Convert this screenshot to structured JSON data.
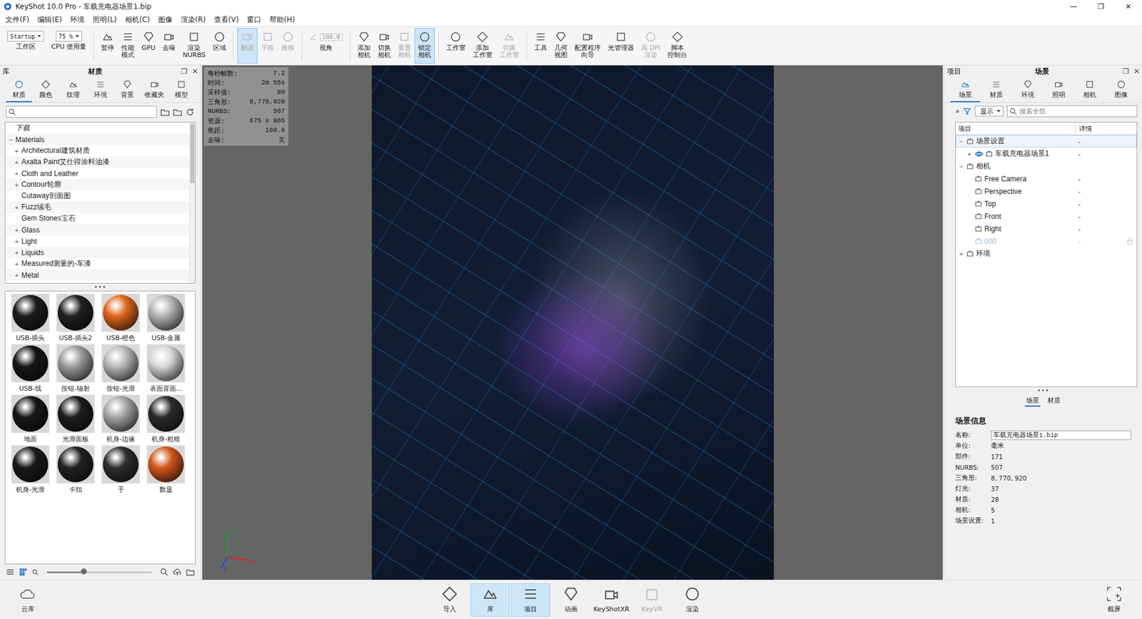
{
  "window": {
    "title": "KeyShot 10.0 Pro  - 车载充电器场景1.bip",
    "controls": [
      "—",
      "❐",
      "✕"
    ]
  },
  "menu": [
    "文件(F)",
    "编辑(E)",
    "环境",
    "照明(L)",
    "相机(C)",
    "图像",
    "渲染(R)",
    "查看(V)",
    "窗口",
    "帮助(H)"
  ],
  "toolbar": [
    {
      "items": [
        {
          "kind": "dropdown",
          "value": "Startup",
          "label": "工作区",
          "disabled": false,
          "selected": false
        },
        {
          "kind": "dropdown",
          "value": "75 %",
          "label": "CPU 使用量",
          "disabled": false,
          "selected": false
        }
      ]
    },
    {
      "items": [
        {
          "kind": "button",
          "label": "暂停",
          "disabled": false,
          "selected": false
        },
        {
          "kind": "button",
          "label": "性能\n模式",
          "disabled": false,
          "selected": false
        },
        {
          "kind": "button",
          "label": "GPU",
          "disabled": false,
          "selected": false
        },
        {
          "kind": "button",
          "label": "去噪",
          "disabled": false,
          "selected": false
        },
        {
          "kind": "button",
          "label": "渲染\nNURBS",
          "disabled": false,
          "selected": false
        },
        {
          "kind": "button",
          "label": "区域",
          "disabled": false,
          "selected": false
        }
      ]
    },
    {
      "items": [
        {
          "kind": "button",
          "label": "翻滚",
          "disabled": true,
          "selected": true
        },
        {
          "kind": "button",
          "label": "平移",
          "disabled": true,
          "selected": false
        },
        {
          "kind": "button",
          "label": "推移",
          "disabled": true,
          "selected": false
        }
      ]
    },
    {
      "items": [
        {
          "kind": "field",
          "value": "100.0",
          "label": "视角",
          "disabled": false,
          "selected": false
        }
      ]
    },
    {
      "items": [
        {
          "kind": "button",
          "label": "添加\n相机",
          "disabled": false,
          "selected": false
        },
        {
          "kind": "button",
          "label": "切换\n相机",
          "disabled": false,
          "selected": false
        },
        {
          "kind": "button",
          "label": "重置\n相机",
          "disabled": true,
          "selected": false
        },
        {
          "kind": "button",
          "label": "锁定\n相机",
          "disabled": false,
          "selected": true
        }
      ]
    },
    {
      "items": [
        {
          "kind": "button",
          "label": "工作室",
          "disabled": false,
          "selected": false
        },
        {
          "kind": "button",
          "label": "添加\n工作室",
          "disabled": false,
          "selected": false
        },
        {
          "kind": "button",
          "label": "切换\n工作室",
          "disabled": true,
          "selected": false
        }
      ]
    },
    {
      "items": [
        {
          "kind": "button",
          "label": "工具",
          "disabled": false,
          "selected": false
        },
        {
          "kind": "button",
          "label": "几何\n视图",
          "disabled": false,
          "selected": false
        },
        {
          "kind": "button",
          "label": "配置程序\n向导",
          "disabled": false,
          "selected": false
        },
        {
          "kind": "button",
          "label": "光管理器",
          "disabled": false,
          "selected": false
        },
        {
          "kind": "button",
          "label": "高 DPI\n渲染",
          "disabled": true,
          "selected": false
        },
        {
          "kind": "button",
          "label": "脚本\n控制台",
          "disabled": false,
          "selected": false
        }
      ]
    }
  ],
  "library": {
    "panel": "库",
    "title": "材质",
    "controls": [
      "❐",
      "✕"
    ],
    "tabs": [
      {
        "label": "材质",
        "selected": true
      },
      {
        "label": "颜色",
        "selected": false
      },
      {
        "label": "纹理",
        "selected": false
      },
      {
        "label": "环境",
        "selected": false
      },
      {
        "label": "背景",
        "selected": false
      },
      {
        "label": "收藏夹",
        "selected": false
      },
      {
        "label": "模型",
        "selected": false
      }
    ],
    "tree": [
      {
        "label": "下载",
        "toggle": "",
        "depth": 0,
        "italic": true
      },
      {
        "label": "Materials",
        "toggle": "−",
        "depth": 0,
        "italic": false
      },
      {
        "label": "Architectural建筑材质",
        "toggle": "+",
        "depth": 1,
        "italic": false
      },
      {
        "label": "Axalta Paint艾仕得涂料油漆",
        "toggle": "+",
        "depth": 1,
        "italic": false
      },
      {
        "label": "Cloth and Leather",
        "toggle": "+",
        "depth": 1,
        "italic": false
      },
      {
        "label": "Contour轮廓",
        "toggle": "+",
        "depth": 1,
        "italic": false
      },
      {
        "label": "Cutaway剖面图",
        "toggle": "",
        "depth": 1,
        "italic": false
      },
      {
        "label": "Fuzz绒毛",
        "toggle": "+",
        "depth": 1,
        "italic": false
      },
      {
        "label": "Gem Stones宝石",
        "toggle": "",
        "depth": 1,
        "italic": false
      },
      {
        "label": "Glass",
        "toggle": "+",
        "depth": 1,
        "italic": false
      },
      {
        "label": "Light",
        "toggle": "+",
        "depth": 1,
        "italic": false
      },
      {
        "label": "Liquids",
        "toggle": "+",
        "depth": 1,
        "italic": false
      },
      {
        "label": "Measured测量的-车漆",
        "toggle": "+",
        "depth": 1,
        "italic": false
      },
      {
        "label": "Metal",
        "toggle": "+",
        "depth": 1,
        "italic": false
      }
    ],
    "divider": "•••",
    "materials": [
      {
        "name": "USB-插头",
        "color": "#1c1c1c"
      },
      {
        "name": "USB-插头2",
        "color": "#202020"
      },
      {
        "name": "USB-橙色",
        "color": "#e0661e"
      },
      {
        "name": "USB-金属",
        "color": "#b4b4b4"
      },
      {
        "name": "USB-线",
        "color": "#161616"
      },
      {
        "name": "按钮-辐射",
        "color": "#9c9c9c"
      },
      {
        "name": "按钮-光滑",
        "color": "#b8b8b8"
      },
      {
        "name": "表面背面...",
        "color": "#d6d6d6"
      },
      {
        "name": "地面",
        "color": "#181818"
      },
      {
        "name": "光滑面板",
        "color": "#1d1d1d"
      },
      {
        "name": "机身-边缘",
        "color": "#a6a6a6"
      },
      {
        "name": "机身-粗糙",
        "color": "#2c2c2c"
      },
      {
        "name": "机身-光滑",
        "color": "#1a1a1a"
      },
      {
        "name": "卡扣",
        "color": "#222222"
      },
      {
        "name": "手",
        "color": "#2e2e2e"
      },
      {
        "name": "数显",
        "color": "#d4561c"
      }
    ],
    "zoom": {
      "level": 0.35
    }
  },
  "viewport": {
    "stats": [
      {
        "label": "每秒帧数:",
        "value": "7.2"
      },
      {
        "label": "时间:",
        "value": "2m 55s"
      },
      {
        "label": "采样值:",
        "value": "90"
      },
      {
        "label": "三角形:",
        "value": "8,770,920"
      },
      {
        "label": "NURBS:",
        "value": "507"
      },
      {
        "label": "资源:",
        "value": "675 x 865"
      },
      {
        "label": "焦距:",
        "value": "100.0"
      },
      {
        "label": "去噪:",
        "value": "关"
      }
    ],
    "axes": [
      {
        "label": "y",
        "color": "#19a319"
      },
      {
        "label": "x",
        "color": "#e02020"
      },
      {
        "label": "z",
        "color": "#2444e0"
      }
    ]
  },
  "project": {
    "panel": "项目",
    "title": "场景",
    "controls": [
      "❐",
      "✕"
    ],
    "tabs": [
      {
        "label": "场景",
        "selected": true
      },
      {
        "label": "材质",
        "selected": false
      },
      {
        "label": "环境",
        "selected": false
      },
      {
        "label": "照明",
        "selected": false
      },
      {
        "label": "相机",
        "selected": false
      },
      {
        "label": "图像",
        "selected": false
      }
    ],
    "filter": {
      "toggle": "»",
      "display": "显示",
      "search": "搜索全部"
    },
    "columns": [
      "项目",
      "详情"
    ],
    "rows": [
      {
        "label": "场景设置",
        "detail": "-",
        "toggle": "−",
        "depth": 0,
        "eye": false,
        "disabled": false,
        "locked": false,
        "selected": true
      },
      {
        "label": "车载充电器场景1",
        "detail": "-",
        "toggle": "+",
        "depth": 1,
        "eye": true,
        "disabled": false,
        "locked": false,
        "selected": false
      },
      {
        "label": "相机",
        "detail": "",
        "toggle": "−",
        "depth": 0,
        "eye": false,
        "disabled": false,
        "locked": false,
        "selected": false
      },
      {
        "label": "Free Camera",
        "detail": "-",
        "toggle": "",
        "depth": 1,
        "eye": false,
        "disabled": false,
        "locked": false,
        "selected": false
      },
      {
        "label": "Perspective",
        "detail": "-",
        "toggle": "",
        "depth": 1,
        "eye": false,
        "disabled": false,
        "locked": false,
        "selected": false
      },
      {
        "label": "Top",
        "detail": "-",
        "toggle": "",
        "depth": 1,
        "eye": false,
        "disabled": false,
        "locked": false,
        "selected": false
      },
      {
        "label": "Front",
        "detail": "-",
        "toggle": "",
        "depth": 1,
        "eye": false,
        "disabled": false,
        "locked": false,
        "selected": false
      },
      {
        "label": "Right",
        "detail": "-",
        "toggle": "",
        "depth": 1,
        "eye": false,
        "disabled": false,
        "locked": false,
        "selected": false
      },
      {
        "label": "000",
        "detail": "-",
        "toggle": "",
        "depth": 1,
        "eye": false,
        "disabled": true,
        "locked": true,
        "selected": false
      },
      {
        "label": "环境",
        "detail": "",
        "toggle": "+",
        "depth": 0,
        "eye": false,
        "disabled": false,
        "locked": false,
        "selected": false
      }
    ],
    "divider": "•••",
    "subtabs": [
      {
        "label": "场景",
        "selected": true
      },
      {
        "label": "材质",
        "selected": false
      }
    ],
    "info": {
      "title": "场景信息",
      "fields": [
        {
          "label": "名称:",
          "value": "车载充电器场景1.bip",
          "kind": "input"
        },
        {
          "label": "单位:",
          "value": "毫米",
          "kind": "text"
        },
        {
          "label": "部件:",
          "value": "171",
          "kind": "text"
        },
        {
          "label": "NURBS:",
          "value": "507",
          "kind": "text"
        },
        {
          "label": "三角形:",
          "value": "8, 770, 920",
          "kind": "text"
        },
        {
          "label": "灯光:",
          "value": "37",
          "kind": "text"
        },
        {
          "label": "材质:",
          "value": "28",
          "kind": "text"
        },
        {
          "label": "相机:",
          "value": "5",
          "kind": "text"
        },
        {
          "label": "场景设置:",
          "value": "1",
          "kind": "text"
        }
      ]
    }
  },
  "bottombar": {
    "left": "云库",
    "items": [
      {
        "label": "导入",
        "selected": false,
        "disabled": false
      },
      {
        "label": "库",
        "selected": true,
        "disabled": false
      },
      {
        "label": "项目",
        "selected": true,
        "disabled": false
      },
      {
        "label": "动画",
        "selected": false,
        "disabled": false
      },
      {
        "label": "KeyShotXR",
        "selected": false,
        "disabled": false
      },
      {
        "label": "KeyVR",
        "selected": false,
        "disabled": true
      },
      {
        "label": "渲染",
        "selected": false,
        "disabled": false
      }
    ],
    "right": "截屏"
  }
}
